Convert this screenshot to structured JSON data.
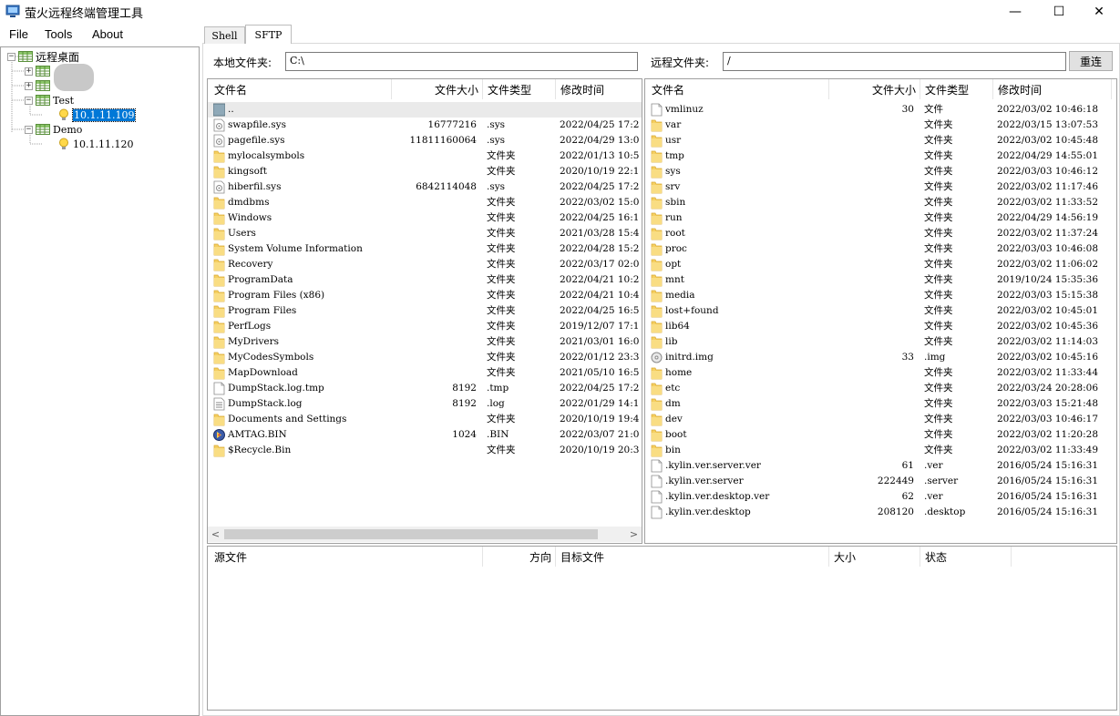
{
  "window": {
    "title": "萤火远程终端管理工具",
    "minimize": "—",
    "maximize": "☐",
    "close": "✕"
  },
  "menu": {
    "file": "File",
    "tools": "Tools",
    "about": "About"
  },
  "tree": {
    "root": "远程桌面",
    "groups": [
      {
        "name": "",
        "host": ""
      },
      {
        "name": "",
        "host": ""
      },
      {
        "name": "Test",
        "host": "10.1.11.109"
      },
      {
        "name": "Demo",
        "host": "10.1.11.120"
      }
    ]
  },
  "tabs": [
    {
      "label": "Shell"
    },
    {
      "label": "SFTP"
    }
  ],
  "local": {
    "label": "本地文件夹:",
    "path": "C:\\"
  },
  "remote": {
    "label": "远程文件夹:",
    "path": "/",
    "refresh": "重连"
  },
  "columns": {
    "name": "文件名",
    "size": "文件大小",
    "type": "文件类型",
    "mtime": "修改时间"
  },
  "local_files": [
    {
      "name": "..",
      "size": "",
      "type": "",
      "mtime": "",
      "icon": "up"
    },
    {
      "name": "swapfile.sys",
      "size": "16777216",
      "type": ".sys",
      "mtime": "2022/04/25 17:2",
      "icon": "sys"
    },
    {
      "name": "pagefile.sys",
      "size": "11811160064",
      "type": ".sys",
      "mtime": "2022/04/29 13:0",
      "icon": "sys"
    },
    {
      "name": "mylocalsymbols",
      "size": "",
      "type": "文件夹",
      "mtime": "2022/01/13 10:5",
      "icon": "folder"
    },
    {
      "name": "kingsoft",
      "size": "",
      "type": "文件夹",
      "mtime": "2020/10/19 22:1",
      "icon": "folder"
    },
    {
      "name": "hiberfil.sys",
      "size": "6842114048",
      "type": ".sys",
      "mtime": "2022/04/25 17:2",
      "icon": "sys"
    },
    {
      "name": "dmdbms",
      "size": "",
      "type": "文件夹",
      "mtime": "2022/03/02 15:0",
      "icon": "folder"
    },
    {
      "name": "Windows",
      "size": "",
      "type": "文件夹",
      "mtime": "2022/04/25 16:1",
      "icon": "folder"
    },
    {
      "name": "Users",
      "size": "",
      "type": "文件夹",
      "mtime": "2021/03/28 15:4",
      "icon": "folder"
    },
    {
      "name": "System Volume Information",
      "size": "",
      "type": "文件夹",
      "mtime": "2022/04/28 15:2",
      "icon": "folder"
    },
    {
      "name": "Recovery",
      "size": "",
      "type": "文件夹",
      "mtime": "2022/03/17 02:0",
      "icon": "folder"
    },
    {
      "name": "ProgramData",
      "size": "",
      "type": "文件夹",
      "mtime": "2022/04/21 10:2",
      "icon": "folder"
    },
    {
      "name": "Program Files (x86)",
      "size": "",
      "type": "文件夹",
      "mtime": "2022/04/21 10:4",
      "icon": "folder"
    },
    {
      "name": "Program Files",
      "size": "",
      "type": "文件夹",
      "mtime": "2022/04/25 16:5",
      "icon": "folder"
    },
    {
      "name": "PerfLogs",
      "size": "",
      "type": "文件夹",
      "mtime": "2019/12/07 17:1",
      "icon": "folder"
    },
    {
      "name": "MyDrivers",
      "size": "",
      "type": "文件夹",
      "mtime": "2021/03/01 16:0",
      "icon": "folder"
    },
    {
      "name": "MyCodesSymbols",
      "size": "",
      "type": "文件夹",
      "mtime": "2022/01/12 23:3",
      "icon": "folder"
    },
    {
      "name": "MapDownload",
      "size": "",
      "type": "文件夹",
      "mtime": "2021/05/10 16:5",
      "icon": "folder"
    },
    {
      "name": "DumpStack.log.tmp",
      "size": "8192",
      "type": ".tmp",
      "mtime": "2022/04/25 17:2",
      "icon": "file"
    },
    {
      "name": "DumpStack.log",
      "size": "8192",
      "type": ".log",
      "mtime": "2022/01/29 14:1",
      "icon": "log"
    },
    {
      "name": "Documents and Settings",
      "size": "",
      "type": "文件夹",
      "mtime": "2020/10/19 19:4",
      "icon": "folder"
    },
    {
      "name": "AMTAG.BIN",
      "size": "1024",
      "type": ".BIN",
      "mtime": "2022/03/07 21:0",
      "icon": "bin"
    },
    {
      "name": "$Recycle.Bin",
      "size": "",
      "type": "文件夹",
      "mtime": "2020/10/19 20:3",
      "icon": "folder"
    }
  ],
  "remote_files": [
    {
      "name": "vmlinuz",
      "size": "30",
      "type": "文件",
      "mtime": "2022/03/02 10:46:18",
      "icon": "file"
    },
    {
      "name": "var",
      "size": "",
      "type": "文件夹",
      "mtime": "2022/03/15 13:07:53",
      "icon": "folder"
    },
    {
      "name": "usr",
      "size": "",
      "type": "文件夹",
      "mtime": "2022/03/02 10:45:48",
      "icon": "folder"
    },
    {
      "name": "tmp",
      "size": "",
      "type": "文件夹",
      "mtime": "2022/04/29 14:55:01",
      "icon": "folder"
    },
    {
      "name": "sys",
      "size": "",
      "type": "文件夹",
      "mtime": "2022/03/03 10:46:12",
      "icon": "folder"
    },
    {
      "name": "srv",
      "size": "",
      "type": "文件夹",
      "mtime": "2022/03/02 11:17:46",
      "icon": "folder"
    },
    {
      "name": "sbin",
      "size": "",
      "type": "文件夹",
      "mtime": "2022/03/02 11:33:52",
      "icon": "folder"
    },
    {
      "name": "run",
      "size": "",
      "type": "文件夹",
      "mtime": "2022/04/29 14:56:19",
      "icon": "folder"
    },
    {
      "name": "root",
      "size": "",
      "type": "文件夹",
      "mtime": "2022/03/02 11:37:24",
      "icon": "folder"
    },
    {
      "name": "proc",
      "size": "",
      "type": "文件夹",
      "mtime": "2022/03/03 10:46:08",
      "icon": "folder"
    },
    {
      "name": "opt",
      "size": "",
      "type": "文件夹",
      "mtime": "2022/03/02 11:06:02",
      "icon": "folder"
    },
    {
      "name": "mnt",
      "size": "",
      "type": "文件夹",
      "mtime": "2019/10/24 15:35:36",
      "icon": "folder"
    },
    {
      "name": "media",
      "size": "",
      "type": "文件夹",
      "mtime": "2022/03/03 15:15:38",
      "icon": "folder"
    },
    {
      "name": "lost+found",
      "size": "",
      "type": "文件夹",
      "mtime": "2022/03/02 10:45:01",
      "icon": "folder"
    },
    {
      "name": "lib64",
      "size": "",
      "type": "文件夹",
      "mtime": "2022/03/02 10:45:36",
      "icon": "folder"
    },
    {
      "name": "lib",
      "size": "",
      "type": "文件夹",
      "mtime": "2022/03/02 11:14:03",
      "icon": "folder"
    },
    {
      "name": "initrd.img",
      "size": "33",
      "type": ".img",
      "mtime": "2022/03/02 10:45:16",
      "icon": "img"
    },
    {
      "name": "home",
      "size": "",
      "type": "文件夹",
      "mtime": "2022/03/02 11:33:44",
      "icon": "folder"
    },
    {
      "name": "etc",
      "size": "",
      "type": "文件夹",
      "mtime": "2022/03/24 20:28:06",
      "icon": "folder"
    },
    {
      "name": "dm",
      "size": "",
      "type": "文件夹",
      "mtime": "2022/03/03 15:21:48",
      "icon": "folder"
    },
    {
      "name": "dev",
      "size": "",
      "type": "文件夹",
      "mtime": "2022/03/03 10:46:17",
      "icon": "folder"
    },
    {
      "name": "boot",
      "size": "",
      "type": "文件夹",
      "mtime": "2022/03/02 11:20:28",
      "icon": "folder"
    },
    {
      "name": "bin",
      "size": "",
      "type": "文件夹",
      "mtime": "2022/03/02 11:33:49",
      "icon": "folder"
    },
    {
      "name": ".kylin.ver.server.ver",
      "size": "61",
      "type": ".ver",
      "mtime": "2016/05/24 15:16:31",
      "icon": "file"
    },
    {
      "name": ".kylin.ver.server",
      "size": "222449",
      "type": ".server",
      "mtime": "2016/05/24 15:16:31",
      "icon": "file"
    },
    {
      "name": ".kylin.ver.desktop.ver",
      "size": "62",
      "type": ".ver",
      "mtime": "2016/05/24 15:16:31",
      "icon": "file"
    },
    {
      "name": ".kylin.ver.desktop",
      "size": "208120",
      "type": ".desktop",
      "mtime": "2016/05/24 15:16:31",
      "icon": "file"
    }
  ],
  "transfer_columns": {
    "source": "源文件",
    "direction": "方向",
    "target": "目标文件",
    "size": "大小",
    "status": "状态"
  },
  "scroll": {
    "left": "<",
    "right": ">"
  },
  "colors": {
    "selection": "#0078d7",
    "folder": "#f5cf62",
    "header_sep": "#e5e5e5"
  }
}
